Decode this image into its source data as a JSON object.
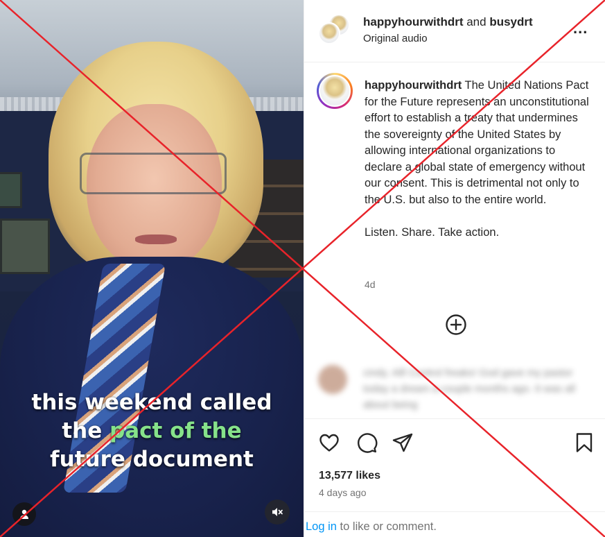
{
  "video": {
    "caption_line1": "this weekend called",
    "caption_line2_white": "the ",
    "caption_line2_green": "pact of the",
    "caption_line3": "future document",
    "caption_highlight_color": "#86e28a",
    "user_icon": "person-icon",
    "mute_icon": "speaker-muted-icon"
  },
  "header": {
    "user1": "happyhourwithdrt",
    "conjunction": "and",
    "user2": "busydrt",
    "audio": "Original audio",
    "more": "..."
  },
  "post": {
    "username": "happyhourwithdrt",
    "body": "The United Nations Pact for the Future represents an unconstitutional effort to establish a treaty that undermines the sovereignty of the United States by allowing international organizations to declare a global state of emergency without our consent. This is detrimental not only to the U.S. but also to the entire world.",
    "cta": "Listen. Share. Take action.",
    "timeago": "4d"
  },
  "comment_preview": {
    "text": "cindy. Alll Control freaks! God gave my pastor today a dream a couple months ago. It was all about being"
  },
  "actions": {
    "like_icon": "heart-icon",
    "comment_icon": "comment-bubble-icon",
    "share_icon": "paper-plane-icon",
    "save_icon": "bookmark-icon",
    "add_icon": "plus-circle-icon"
  },
  "likes": "13,577 likes",
  "date": "4 days ago",
  "login": {
    "link": "Log in",
    "rest": " to like or comment."
  },
  "overlay": {
    "mark": "red-x-overlay",
    "color": "#e8232a"
  }
}
